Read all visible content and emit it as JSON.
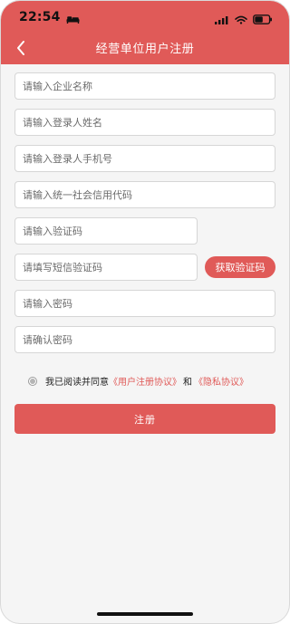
{
  "status_bar": {
    "time": "22:54"
  },
  "nav": {
    "title": "经营单位用户注册"
  },
  "form": {
    "company_placeholder": "请输入企业名称",
    "login_name_placeholder": "请输入登录人姓名",
    "phone_placeholder": "请输入登录人手机号",
    "credit_code_placeholder": "请输入统一社会信用代码",
    "captcha_placeholder": "请输入验证码",
    "sms_code_placeholder": "请填写短信验证码",
    "sms_button_label": "获取验证码",
    "password_placeholder": "请输入密码",
    "confirm_password_placeholder": "请确认密码"
  },
  "agreement": {
    "prefix": "我已阅读并同意",
    "user_agreement": "《用户注册协议》",
    "connector": "和",
    "privacy_agreement": "《隐私协议》"
  },
  "submit_label": "注册",
  "colors": {
    "primary": "#e05a58",
    "background": "#f5f5f5",
    "border": "#d6d6d6"
  },
  "icons": {
    "back": "back-icon",
    "bed": "bed-icon",
    "signal": "signal-icon",
    "wifi": "wifi-icon",
    "battery": "battery-icon"
  }
}
